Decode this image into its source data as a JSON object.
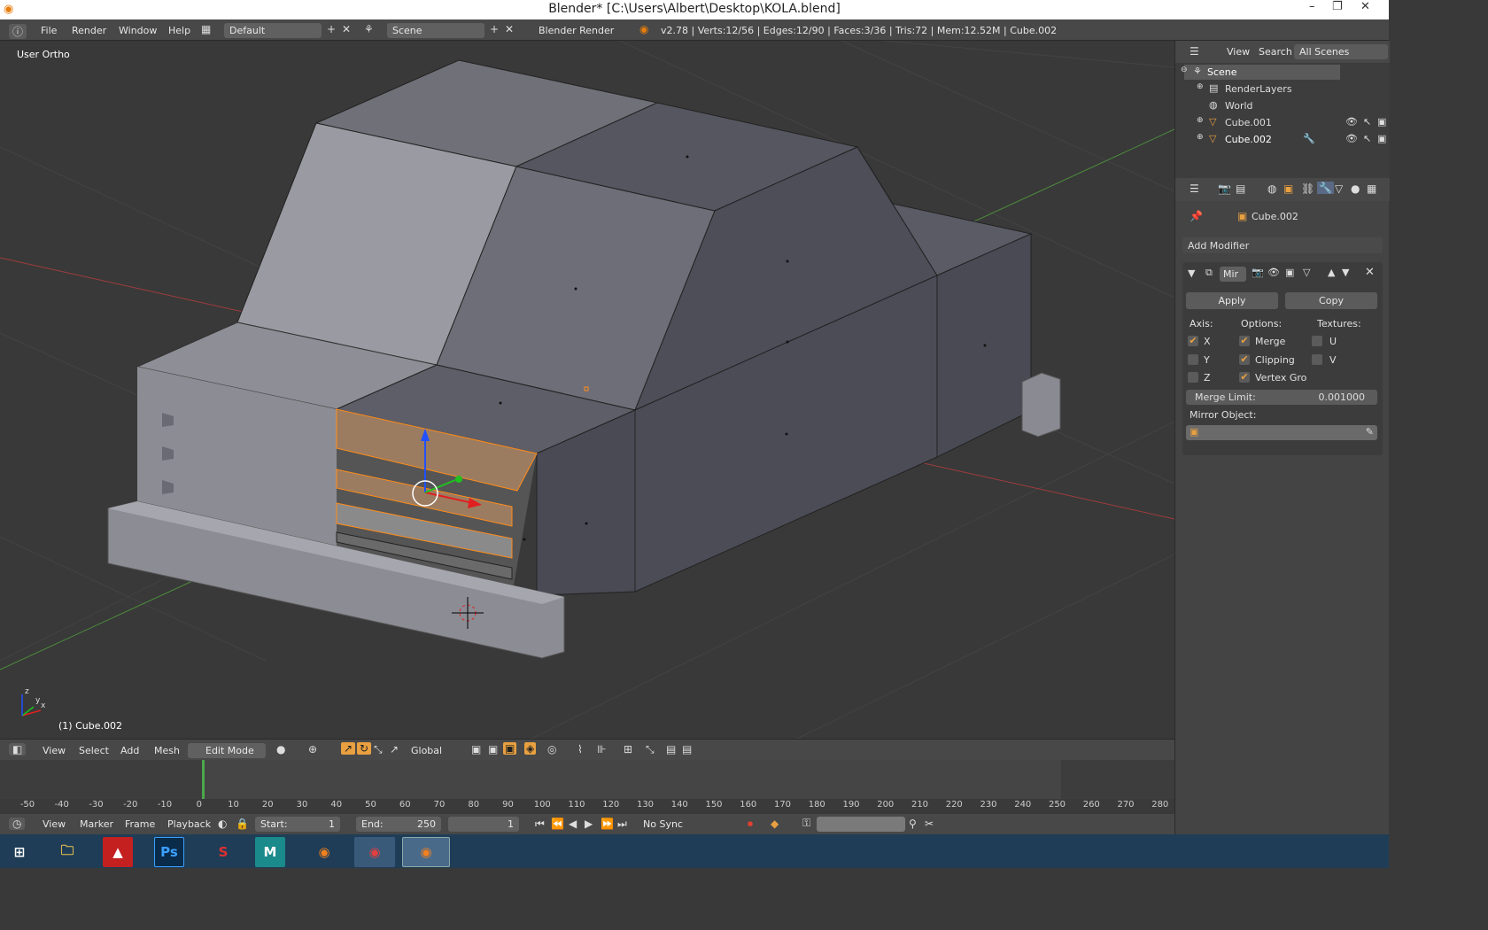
{
  "window": {
    "title": "Blender* [C:\\Users\\Albert\\Desktop\\KOLA.blend]",
    "minimize": "–",
    "maximize": "❐",
    "close": "✕"
  },
  "infobar": {
    "menus": [
      "File",
      "Render",
      "Window",
      "Help"
    ],
    "layout": "Default",
    "scene": "Scene",
    "engine": "Blender Render",
    "stats": "v2.78 | Verts:12/56 | Edges:12/90 | Faces:3/36 | Tris:72 | Mem:12.52M | Cube.002"
  },
  "viewport": {
    "view_label": "User Ortho",
    "object_label": "(1) Cube.002",
    "axis_x": "x",
    "axis_y": "y",
    "axis_z": "z"
  },
  "viewport_header": {
    "menus": [
      "View",
      "Select",
      "Add",
      "Mesh"
    ],
    "mode": "Edit Mode",
    "orientation": "Global"
  },
  "timeline": {
    "ticks": [
      "-50",
      "-40",
      "-30",
      "-20",
      "-10",
      "0",
      "10",
      "20",
      "30",
      "40",
      "50",
      "60",
      "70",
      "80",
      "90",
      "100",
      "110",
      "120",
      "130",
      "140",
      "150",
      "160",
      "170",
      "180",
      "190",
      "200",
      "210",
      "220",
      "230",
      "240",
      "250",
      "260",
      "270",
      "280"
    ],
    "current_frame_marker": "0",
    "menus": [
      "View",
      "Marker",
      "Frame",
      "Playback"
    ],
    "start_label": "Start:",
    "start": "1",
    "end_label": "End:",
    "end": "250",
    "current": "1",
    "sync": "No Sync"
  },
  "outliner": {
    "menus": [
      "View",
      "Search"
    ],
    "filter": "All Scenes",
    "items": [
      "Scene",
      "RenderLayers",
      "World",
      "Cube.001",
      "Cube.002"
    ]
  },
  "properties": {
    "object_name": "Cube.002",
    "add_modifier": "Add Modifier",
    "modifier_name": "Mir",
    "apply": "Apply",
    "copy": "Copy",
    "axis_label": "Axis:",
    "options_label": "Options:",
    "textures_label": "Textures:",
    "axes": [
      "X",
      "Y",
      "Z"
    ],
    "axes_checked": [
      true,
      false,
      false
    ],
    "options": [
      "Merge",
      "Clipping",
      "Vertex Gro"
    ],
    "options_checked": [
      true,
      true,
      true
    ],
    "textures": [
      "U",
      "V"
    ],
    "merge_limit_label": "Merge Limit:",
    "merge_limit": "0.001000",
    "mirror_object_label": "Mirror Object:"
  },
  "taskbar": {
    "apps": [
      "windows",
      "explorer",
      "acrobat",
      "Ps",
      "sketchup",
      "maya",
      "firefox",
      "chrome",
      "blender"
    ],
    "ps_label": "Ps"
  },
  "colors": {
    "accent": "#e8a040",
    "viewport_bg": "#393939",
    "header_bg": "#484848",
    "selected": "#ff8c1a",
    "taskbar": "#1f3d57"
  }
}
